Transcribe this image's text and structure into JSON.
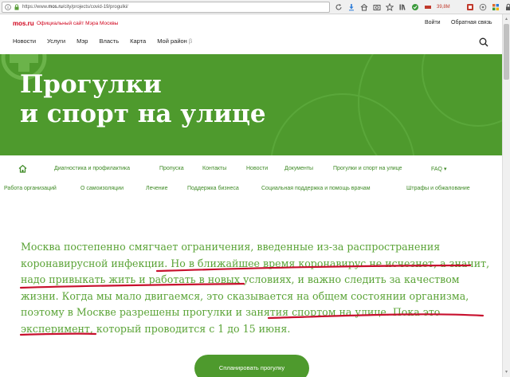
{
  "browser": {
    "url_prefix": "https://www.",
    "url_domain": "mos.ru",
    "url_path": "/city/projects/covid-19/progulki/",
    "memory": "39,8M"
  },
  "header": {
    "logo": "mos.ru",
    "site_name": "Официальный сайт Мэра Москвы",
    "login": "Войти",
    "feedback": "Обратная связь",
    "nav": [
      "Новости",
      "Услуги",
      "Мэр",
      "Власть",
      "Карта",
      "Мой район"
    ],
    "beta": "β"
  },
  "hero": {
    "title_line1": "Прогулки",
    "title_line2": "и спорт на улице",
    "color": "#4e9a2d"
  },
  "subnav": {
    "row1": [
      "Диагностика и профилактика",
      "Пропуска",
      "Контакты",
      "Новости",
      "Документы",
      "Прогулки и спорт на улице",
      "FAQ"
    ],
    "faq_chevron": "▾",
    "row2": [
      "Работа организаций",
      "О самоизоляции",
      "Лечение",
      "Поддержка бизнеса",
      "Социальная поддержка и помощь врачам",
      "Штрафы и обжалование"
    ]
  },
  "lead": {
    "part1": "Москва постепенно смягчает ограничения, введенные из-за распространения коронавирусной инфекции. ",
    "part2": "Но в ближайшее время коронавирус не исчезнет, а значит, надо привыкать жить и работать в новых условиях",
    "part3": ", и важно следить за качеством жизни. Когда мы мало двигаемся, это сказывается на общем состоянии организма, поэтому в Москве разрешены прогулки и занятия спортом на улице. ",
    "part4": "Пока это эксперимент, который проводится с 1 до 15 июня",
    "part5": ".",
    "text_color": "#5aa336",
    "underline_color": "#d0021b"
  },
  "cta": {
    "label": "Спланировать прогулку"
  }
}
